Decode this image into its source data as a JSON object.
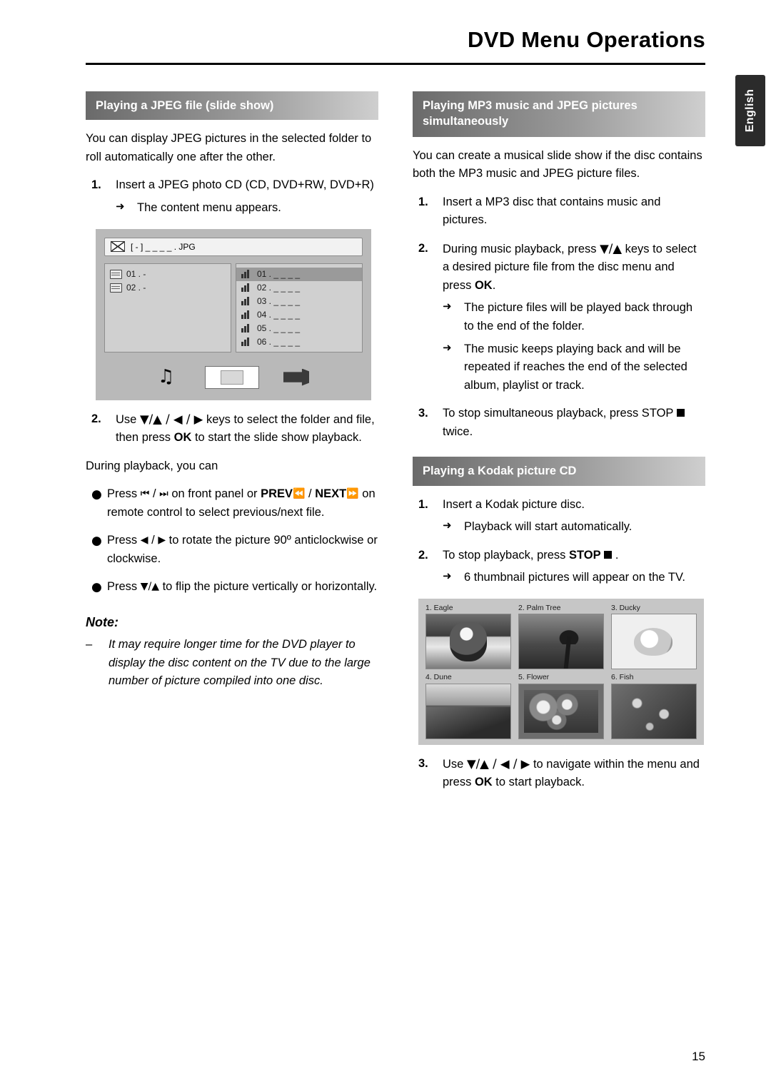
{
  "header": {
    "title": "DVD Menu Operations",
    "language_tab": "English",
    "page_number": "15"
  },
  "left_column": {
    "section1": {
      "heading": "Playing a JPEG file (slide show)",
      "intro": "You can display JPEG pictures in the selected folder to roll automatically one after the other.",
      "step1": {
        "num": "1.",
        "text": "Insert a JPEG photo CD (CD, DVD+RW, DVD+R)",
        "arrow": "The content menu appears."
      },
      "menu_shot": {
        "title": "[ - ] _ _ _ _ . JPG",
        "left_rows": [
          "01 .  -",
          "02 .  -"
        ],
        "right_rows": [
          "01 .  _ _ _ _",
          "02 .  _ _ _ _",
          "03 .  _ _ _ _",
          "04 .  _ _ _ _",
          "05 .  _ _ _ _",
          "06 .  _ _ _ _"
        ],
        "icons": [
          "music-note-icon",
          "picture-icon",
          "film-icon"
        ]
      },
      "step2": {
        "num": "2.",
        "text_before": "Use ",
        "keys": "▼/▲ / ◀ / ▶",
        "text_mid": " keys to select the folder and file, then press ",
        "ok": "OK",
        "text_after": " to start the slide show playback."
      },
      "during_playback": "During playback, you can",
      "bullets": [
        {
          "parts": [
            "Press ",
            "⏮",
            " / ",
            "⏭",
            " on front panel or ",
            "PREV",
            " ⏪",
            " / ",
            "NEXT",
            " ⏩",
            " on remote control to select previous/next file."
          ]
        },
        {
          "parts": [
            "Press ",
            "◀",
            " / ",
            "▶",
            " to rotate the picture 90º anticlockwise or clockwise."
          ]
        },
        {
          "parts": [
            "Press ",
            "▼/▲",
            " to flip the picture vertically or horizontally."
          ]
        }
      ],
      "note_title": "Note:",
      "note_text": "It may require longer time for the DVD player to display the disc content on the TV due to the large number of picture compiled into one disc."
    }
  },
  "right_column": {
    "section2": {
      "heading_line1": "Playing MP3 music and JPEG pictures",
      "heading_line2": "simultaneously",
      "intro": "You can create a musical slide show if the disc contains both the MP3 music and JPEG picture files.",
      "step1": {
        "num": "1.",
        "text": "Insert a MP3 disc that contains music and pictures."
      },
      "step2": {
        "num": "2.",
        "text_before": "During music playback, press ",
        "keys": "▼/▲",
        "text_mid": " keys to select a desired picture file from the disc menu and press ",
        "ok": "OK",
        "text_after": ".",
        "arrow1": "The picture files will be played back through to the end of the folder.",
        "arrow2": "The music keeps playing back and will be repeated if reaches the end of the selected album, playlist or track."
      },
      "step3": {
        "num": "3.",
        "text_before": "To stop simultaneous playback, press STOP ",
        "text_after": " twice."
      }
    },
    "section3": {
      "heading": "Playing a Kodak picture CD",
      "step1": {
        "num": "1.",
        "text": "Insert a Kodak picture disc.",
        "arrow": "Playback will start automatically."
      },
      "step2": {
        "num": "2.",
        "text_before": "To stop playback, press ",
        "stop": "STOP",
        "text_after": " .",
        "arrow": "6 thumbnail pictures will appear on the TV."
      },
      "thumbnails": [
        {
          "label": "1. Eagle",
          "art": "t-eagle"
        },
        {
          "label": "2. Palm Tree",
          "art": "t-palm"
        },
        {
          "label": "3. Ducky",
          "art": "t-ducky"
        },
        {
          "label": "4. Dune",
          "art": "t-dune"
        },
        {
          "label": "5. Flower",
          "art": "t-flower"
        },
        {
          "label": "6. Fish",
          "art": "t-fish"
        }
      ],
      "step3": {
        "num": "3.",
        "text_before": "Use ",
        "keys": "▼/▲ / ◀ / ▶",
        "text_mid": " to navigate within the menu and press ",
        "ok": "OK",
        "text_after": " to start playback."
      }
    }
  }
}
